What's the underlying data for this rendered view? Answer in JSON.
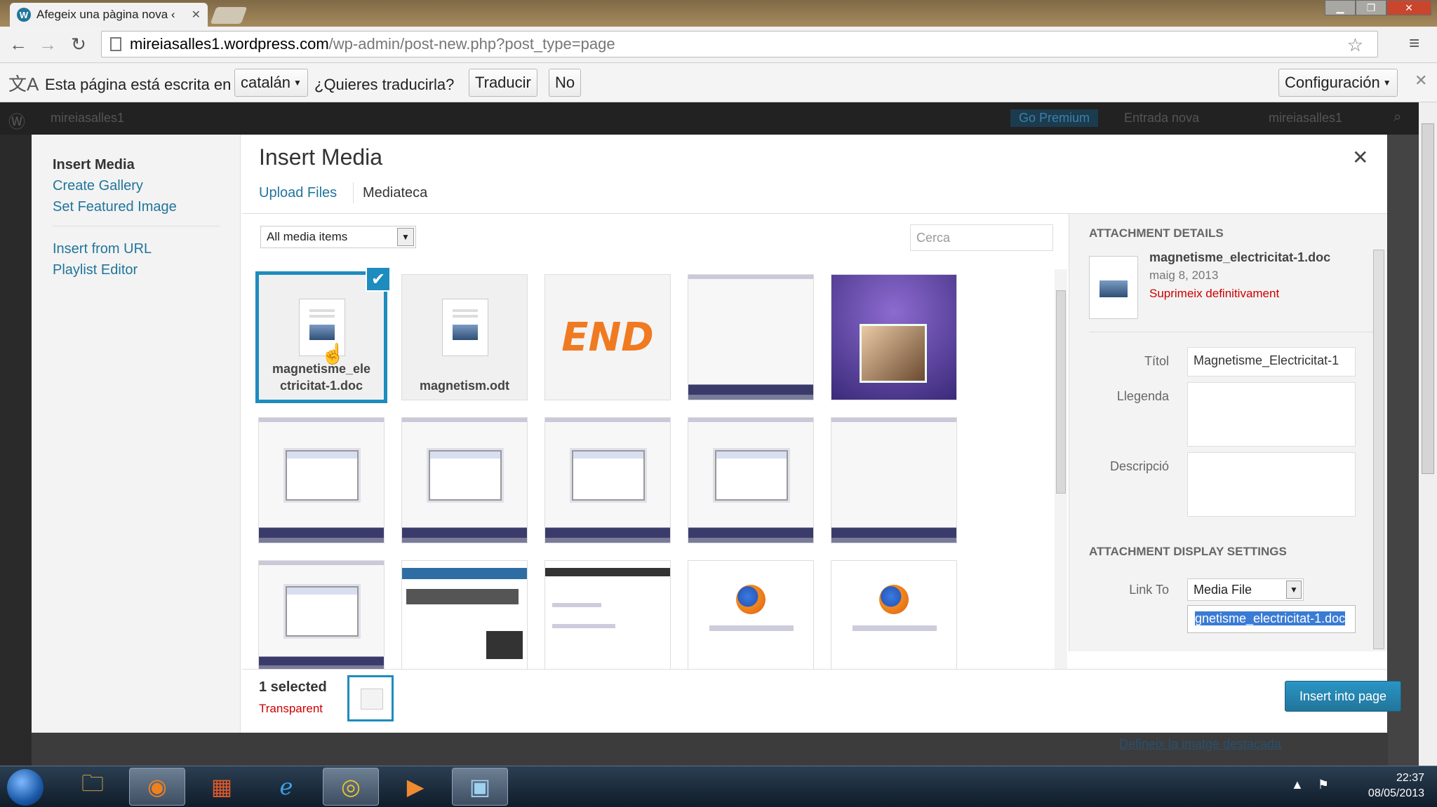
{
  "browser": {
    "tab_title": "Afegeix una pàgina nova ‹",
    "url_host": "mireiasalles1.wordpress.com",
    "url_path": "/wp-admin/post-new.php?post_type=page"
  },
  "translate_bar": {
    "prefix": "Esta página está escrita en",
    "language": "catalán",
    "question": "¿Quieres traducirla?",
    "translate_btn": "Traducir",
    "no_btn": "No",
    "config_btn": "Configuración"
  },
  "admin_bar": {
    "site": "mireiasalles1",
    "go_premium": "Go Premium",
    "new_post": "Entrada nova",
    "user": "mireiasalles1"
  },
  "media_menu": {
    "items": [
      "Insert Media",
      "Create Gallery",
      "Set Featured Image",
      "Insert from URL",
      "Playlist Editor"
    ]
  },
  "frame": {
    "title": "Insert Media",
    "tabs": [
      "Upload Files",
      "Mediateca"
    ]
  },
  "filter": {
    "selected": "All media items",
    "search_placeholder": "Cerca"
  },
  "attachments": [
    {
      "type": "doc",
      "name_line1": "magnetisme_ele",
      "name_line2": "ctricitat-1.doc",
      "selected": true
    },
    {
      "type": "doc",
      "name_line1": "magnetism.odt",
      "name_line2": ""
    },
    {
      "type": "end-art",
      "art_text": "END"
    },
    {
      "type": "screenshot"
    },
    {
      "type": "collage"
    },
    {
      "type": "screenshot-dialog"
    },
    {
      "type": "screenshot-dialog"
    },
    {
      "type": "screenshot-dialog"
    },
    {
      "type": "screenshot-dialog"
    },
    {
      "type": "screenshot"
    },
    {
      "type": "screenshot-dialog"
    },
    {
      "type": "webpage"
    },
    {
      "type": "webpage"
    },
    {
      "type": "firefox"
    },
    {
      "type": "firefox"
    }
  ],
  "details": {
    "heading": "Attachment Details",
    "filename": "magnetisme_electricitat-1.doc",
    "date": "maig 8, 2013",
    "delete_link": "Suprimeix definitivament",
    "title_label": "Títol",
    "title_value": "Magnetisme_Electricitat-1",
    "caption_label": "Llegenda",
    "description_label": "Descripció",
    "display_heading": "Attachment Display Settings",
    "link_to_label": "Link To",
    "link_to_value": "Media File",
    "link_url_visible": "gnetisme_electricitat-1.doc"
  },
  "toolbar": {
    "selected_count": "1 selected",
    "clear_label": "Transparent",
    "insert_button": "Insert into page"
  },
  "background_link": "Defineix la imatge destacada",
  "taskbar": {
    "time": "22:37",
    "date": "08/05/2013"
  },
  "colors": {
    "accent": "#1e8cbe",
    "link": "#21759b",
    "delete": "#cc0000"
  }
}
